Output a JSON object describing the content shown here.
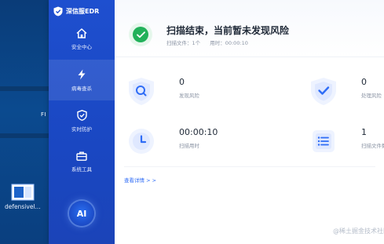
{
  "desktop": {
    "partial_text": "FI",
    "icon_label": "defensivel..."
  },
  "app": {
    "brand_name": "深信服EDR",
    "nav": [
      {
        "label": "安全中心",
        "icon": "home-icon",
        "active": false
      },
      {
        "label": "病毒查杀",
        "icon": "lightning-icon",
        "active": true
      },
      {
        "label": "实时防护",
        "icon": "shield-icon",
        "active": false
      },
      {
        "label": "系统工具",
        "icon": "toolbox-icon",
        "active": false
      }
    ],
    "ai_label": "AI"
  },
  "status": {
    "title": "扫描结束，当前暂未发现风险",
    "files_text": "扫描文件：1个",
    "time_text": "用时：00:00:10",
    "accent": "#22b15a"
  },
  "stats": [
    {
      "value": "0",
      "label": "发现风险",
      "icon": "search-shield-icon"
    },
    {
      "value": "0",
      "label": "处理风险",
      "icon": "check-shield-icon"
    },
    {
      "value": "00:00:10",
      "label": "扫描用时",
      "icon": "clock-icon"
    },
    {
      "value": "1",
      "label": "扫描文件数",
      "icon": "list-icon"
    }
  ],
  "detail_link": "查看详情 > >",
  "watermark": "@稀土掘金技术社区"
}
